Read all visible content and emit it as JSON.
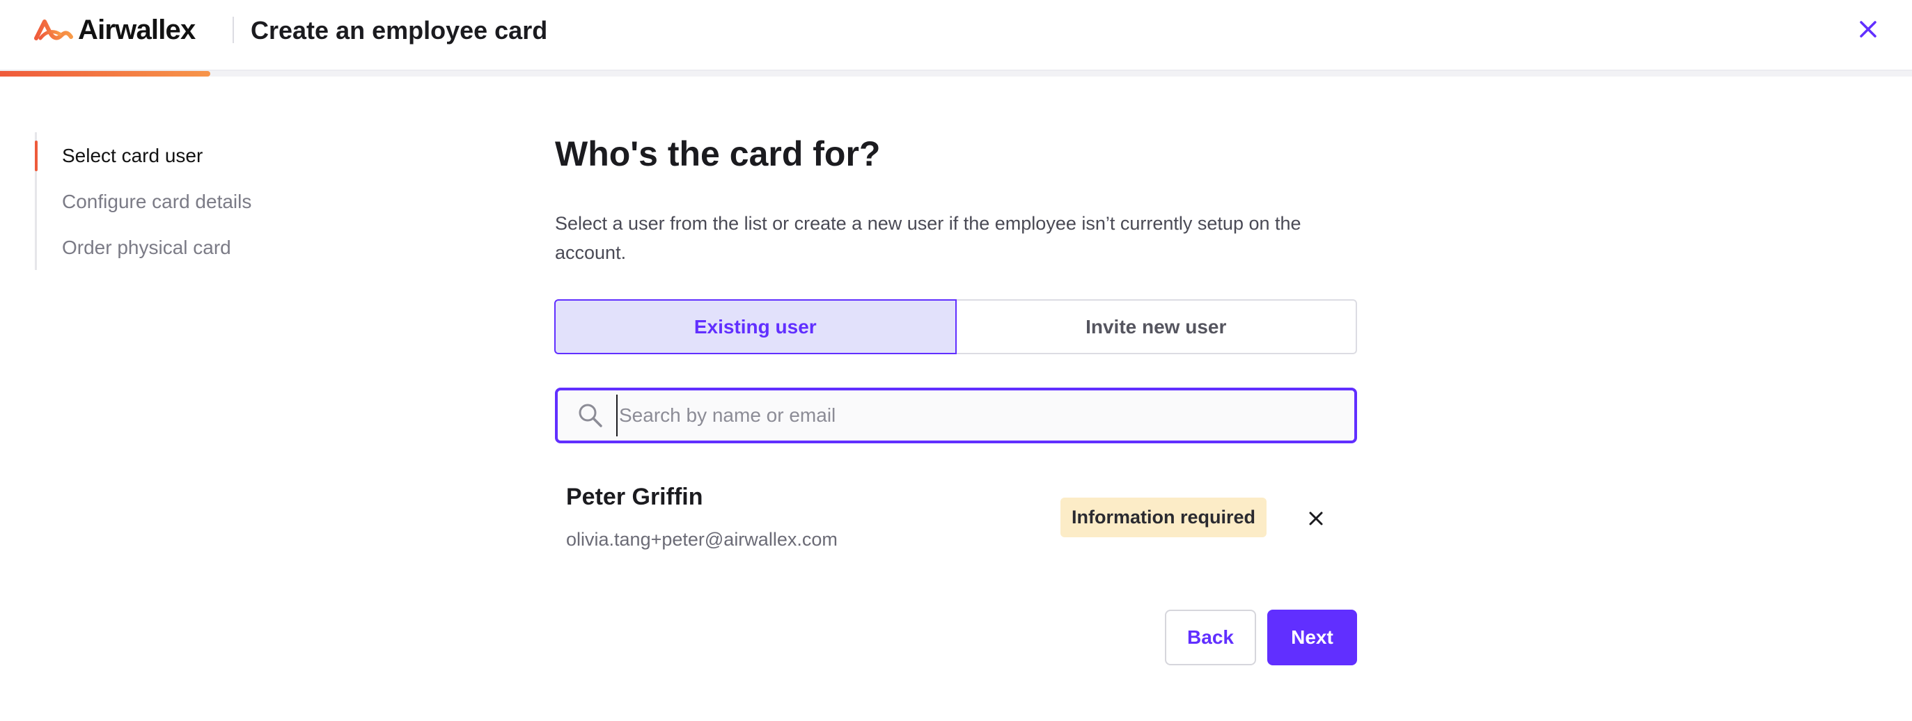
{
  "brand": {
    "name": "Airwallex",
    "logo_icon": "airwallex-logo-icon",
    "accent_color": "#612fff",
    "brand_orange": "#ef5b3b"
  },
  "header": {
    "title": "Create an employee card",
    "close_icon": "close-icon",
    "progress_fraction": 0.11
  },
  "steps": [
    {
      "label": "Select card user",
      "active": true
    },
    {
      "label": "Configure card details",
      "active": false
    },
    {
      "label": "Order physical card",
      "active": false
    }
  ],
  "main": {
    "heading": "Who's the card for?",
    "description": "Select a user from the list or create a new user if the employee isn’t currently setup on the account.",
    "toggle": {
      "options": [
        "Existing user",
        "Invite new user"
      ],
      "selected": "Existing user"
    },
    "search": {
      "placeholder": "Search by name or email",
      "value": "",
      "icon": "search-icon"
    },
    "selected_user": {
      "name": "Peter Griffin",
      "email": "olivia.tang+peter@airwallex.com",
      "status": "Information required",
      "status_color": "#fcecc7",
      "remove_icon": "close-icon"
    },
    "actions": {
      "back_label": "Back",
      "next_label": "Next"
    }
  }
}
